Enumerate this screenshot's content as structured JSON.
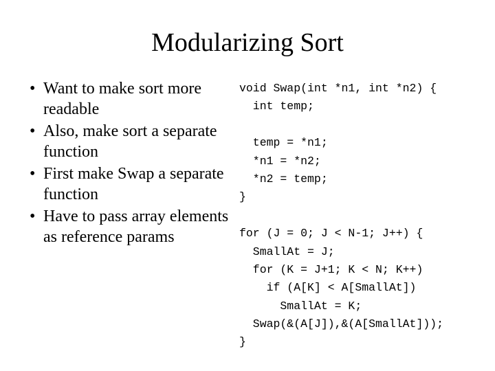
{
  "title": "Modularizing Sort",
  "bullets": [
    "Want to make sort more readable",
    "Also, make sort a separate function",
    "First make Swap a separate function",
    "Have to pass array elements as reference params"
  ],
  "code": "void Swap(int *n1, int *n2) {\n  int temp;\n\n  temp = *n1;\n  *n1 = *n2;\n  *n2 = temp;\n}\n\nfor (J = 0; J < N-1; J++) {\n  SmallAt = J;\n  for (K = J+1; K < N; K++)\n    if (A[K] < A[SmallAt])\n      SmallAt = K;\n  Swap(&(A[J]),&(A[SmallAt]));\n}"
}
